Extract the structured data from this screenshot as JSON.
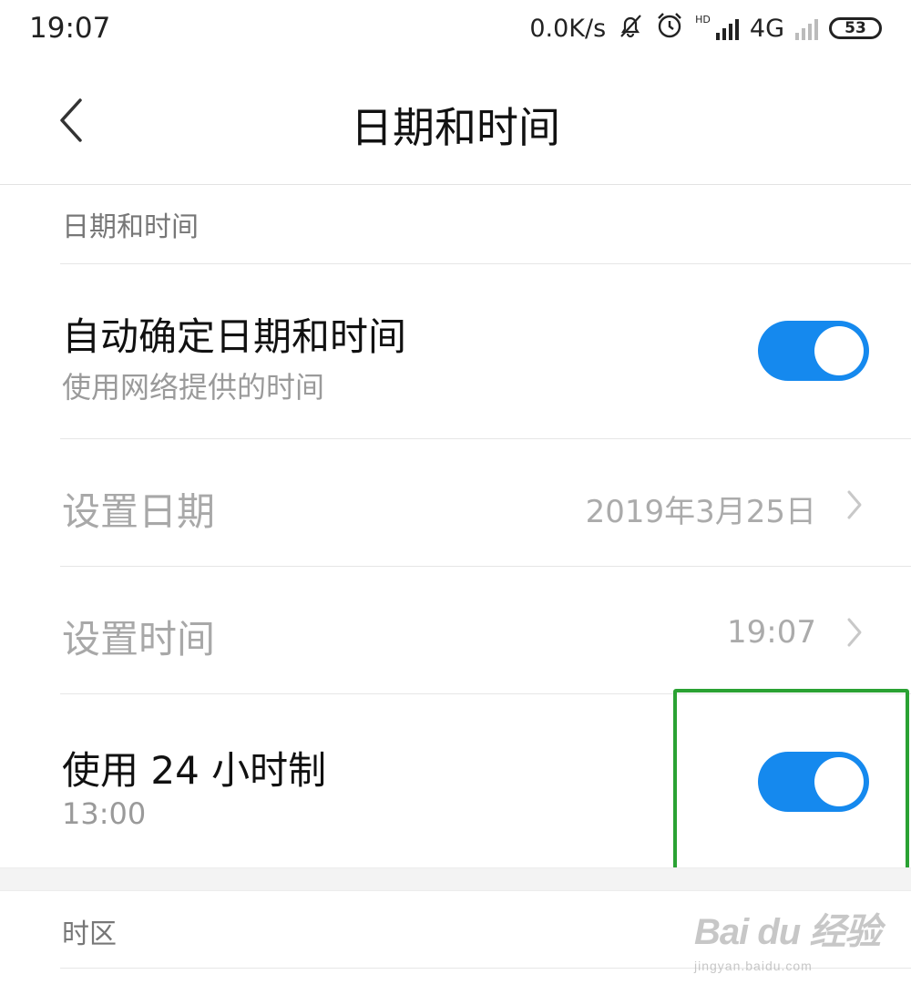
{
  "status_bar": {
    "time": "19:07",
    "net_speed": "0.0K/s",
    "hd_tag": "HD",
    "network": "4G",
    "battery": "53"
  },
  "header": {
    "title": "日期和时间"
  },
  "section_datetime": {
    "label": "日期和时间"
  },
  "auto_datetime": {
    "title": "自动确定日期和时间",
    "subtitle": "使用网络提供的时间",
    "enabled": true
  },
  "set_date": {
    "title": "设置日期",
    "value": "2019年3月25日"
  },
  "set_time": {
    "title": "设置时间",
    "value": "19:07"
  },
  "use_24h": {
    "title": "使用 24 小时制",
    "subtitle": "13:00",
    "enabled": true
  },
  "section_timezone": {
    "label": "时区"
  },
  "watermark": {
    "brand": "Bai du 经验",
    "url": "jingyan.baidu.com"
  },
  "colors": {
    "toggle_on": "#1589ee",
    "highlight": "#2aa233"
  },
  "icons": [
    "back-arrow-icon",
    "mute-bell-icon",
    "alarm-icon",
    "signal-icon",
    "battery-icon",
    "chevron-right-icon"
  ]
}
